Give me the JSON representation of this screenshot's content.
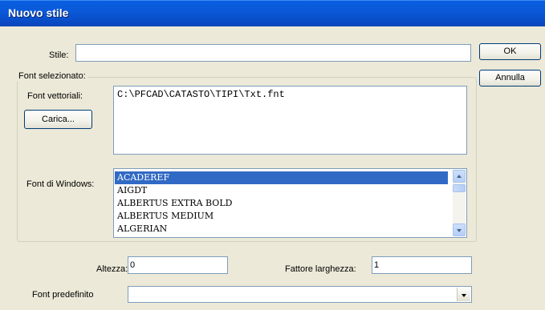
{
  "window": {
    "title": "Nuovo stile"
  },
  "stile": {
    "label": "Stile:",
    "value": ""
  },
  "buttons": {
    "ok": "OK",
    "cancel": "Annulla",
    "load": "Carica..."
  },
  "font_group": {
    "label": "Font selezionato:",
    "vector_label": "Font vettoriali:",
    "vector_path": "C:\\PFCAD\\CATASTO\\TIPI\\Txt.fnt",
    "windows_label": "Font di Windows:",
    "windows_fonts": [
      "ACADEREF",
      "AIGDT",
      "ALBERTUS EXTRA BOLD",
      "ALBERTUS MEDIUM",
      "ALGERIAN"
    ],
    "selected_index": 0
  },
  "height": {
    "label": "Altezza:",
    "value": "0"
  },
  "width_factor": {
    "label": "Fattore larghezza:",
    "value": "1"
  },
  "default_font": {
    "label": "Font predefinito",
    "value": ""
  },
  "colors": {
    "titlebar": "#0a5fe0",
    "selection": "#316ac5"
  }
}
